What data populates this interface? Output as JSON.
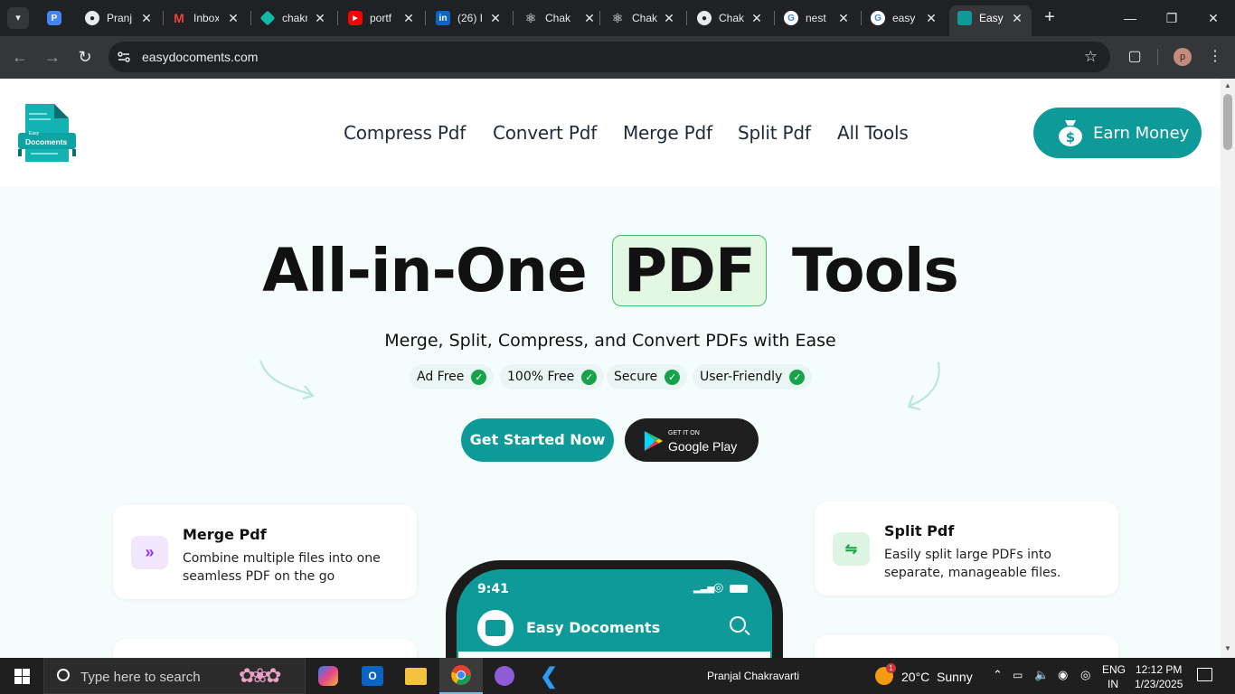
{
  "browser": {
    "tabs": [
      {
        "title": "",
        "icon": "tab-search-icon",
        "color": "#4285f4"
      },
      {
        "title": "Pranj",
        "icon": "github-icon",
        "color": "#e8eaed"
      },
      {
        "title": "Inbox",
        "icon": "gmail-icon",
        "color": "#ea4335"
      },
      {
        "title": "chakr",
        "icon": "chakra-icon",
        "color": "#14b8a6"
      },
      {
        "title": "portf",
        "icon": "youtube-icon",
        "color": "#ff0000"
      },
      {
        "title": "(26) I",
        "icon": "linkedin-icon",
        "color": "#0a66c2"
      },
      {
        "title": "Chak",
        "icon": "react-icon",
        "color": "#9aa0a6"
      },
      {
        "title": "Chak",
        "icon": "react-icon",
        "color": "#9aa0a6"
      },
      {
        "title": "Chak",
        "icon": "github-icon",
        "color": "#e8eaed"
      },
      {
        "title": "nest",
        "icon": "google-icon",
        "color": "#4285f4"
      },
      {
        "title": "easy",
        "icon": "google-icon",
        "color": "#4285f4"
      },
      {
        "title": "Easy",
        "icon": "easydocs-icon",
        "color": "#0f9a9a"
      }
    ],
    "url": "easydocoments.com"
  },
  "site": {
    "logo": {
      "line1": "Easy",
      "line2": "Docoments"
    },
    "nav": [
      "Compress Pdf",
      "Convert Pdf",
      "Merge Pdf",
      "Split Pdf",
      "All Tools"
    ],
    "earn_money": "Earn Money",
    "hero": {
      "before": "All-in-One",
      "highlight": "PDF",
      "after": "Tools"
    },
    "subtitle": "Merge, Split, Compress, and Convert PDFs with Ease",
    "badges": [
      "Ad Free",
      "100% Free",
      "Secure",
      "User-Friendly"
    ],
    "get_started": "Get Started Now",
    "google_play": {
      "small": "GET IT ON",
      "big": "Google Play"
    },
    "features": [
      {
        "title": "Merge Pdf",
        "desc": "Combine multiple files into one seamless PDF on the go"
      },
      {
        "title": "Split Pdf",
        "desc": "Easily split large PDFs into separate, manageable files."
      }
    ],
    "phone": {
      "time": "9:41",
      "app_title": "Easy Docoments"
    }
  },
  "taskbar": {
    "search_placeholder": "Type here to search",
    "user": "Pranjal Chakravarti",
    "weather": {
      "temp": "20°C",
      "condition": "Sunny",
      "badge": "1"
    },
    "lang": {
      "line1": "ENG",
      "line2": "IN"
    },
    "clock": {
      "time": "12:12 PM",
      "date": "1/23/2025"
    }
  },
  "colors": {
    "brand": "#0f9a9a",
    "check": "#16a34a",
    "highlight_bg": "#e3f8e3"
  }
}
